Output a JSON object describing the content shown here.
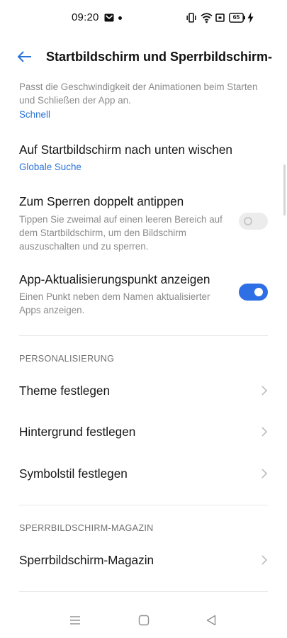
{
  "status_bar": {
    "time": "09:20",
    "battery_level": "65",
    "icons": [
      "gmail-icon",
      "notification-dot-icon",
      "vibrate-icon",
      "wifi-icon",
      "sim-icon",
      "battery-icon",
      "charging-icon"
    ]
  },
  "header": {
    "title": "Startbildschirm und Sperrbildschirm-..."
  },
  "settings": {
    "animation": {
      "description": "Passt die Geschwindigkeit der Animationen beim Starten und Schließen der App an.",
      "value": "Schnell"
    },
    "swipe_down": {
      "title": "Auf Startbildschirm nach unten wischen",
      "value": "Globale Suche"
    },
    "double_tap": {
      "title": "Zum Sperren doppelt antippen",
      "description": "Tippen Sie zweimal auf einen leeren Bereich auf dem Startbildschirm, um den Bildschirm auszuschalten und zu sperren.",
      "enabled": false
    },
    "update_dot": {
      "title": "App-Aktualisierungspunkt anzeigen",
      "description": "Einen Punkt neben dem Namen aktualisierter Apps anzeigen.",
      "enabled": true
    }
  },
  "personalization": {
    "header": "PERSONALISIERUNG",
    "items": [
      {
        "label": "Theme festlegen"
      },
      {
        "label": "Hintergrund festlegen"
      },
      {
        "label": "Symbolstil festlegen"
      }
    ]
  },
  "magazine": {
    "header": "SPERRBILDSCHIRM-MAGAZIN",
    "items": [
      {
        "label": "Sperrbildschirm-Magazin"
      }
    ]
  },
  "nav_bar": {
    "buttons": [
      "menu-icon",
      "home-icon",
      "back-icon"
    ]
  },
  "colors": {
    "accent": "#2f6fe6",
    "link": "#2a73d9",
    "secondary_text": "#8a8a8a"
  }
}
